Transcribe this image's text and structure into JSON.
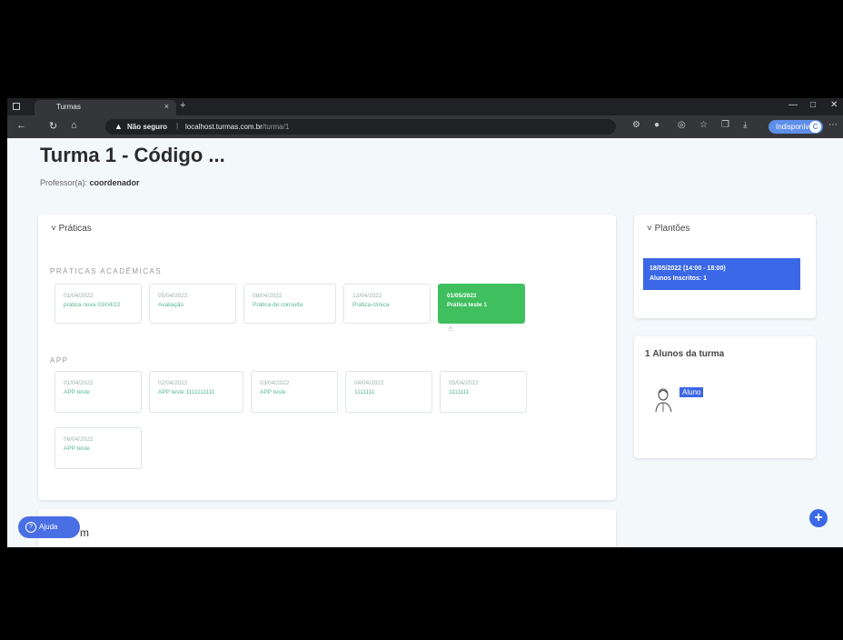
{
  "browser": {
    "tab_title": "Turmas",
    "tab_close": "×",
    "new_tab": "+",
    "not_secure": "Não seguro",
    "separator": "|",
    "url_host": "localhost.turmas.com.br",
    "url_path": "/turma/1",
    "profile_label": "Indisponível",
    "profile_initial": "C"
  },
  "page": {
    "title": "Turma 1 - Código ...",
    "professor_label": "Professor(a):",
    "professor_name": "coordenador"
  },
  "praticas": {
    "heading": "Práticas",
    "academicas_label": "PRÁTICAS ACADÊMICAS",
    "academicas": [
      {
        "l1": "01/04/2022",
        "l2": "prática nova 03/04/22",
        "active": false
      },
      {
        "l1": "05/04/2022",
        "l2": "Avaliação",
        "active": false
      },
      {
        "l1": "08/04/2022",
        "l2": "Prática de consulta",
        "active": false
      },
      {
        "l1": "12/04/2022",
        "l2": "Prática clínica",
        "active": false
      },
      {
        "l1": "01/05/2022",
        "l2": "Prática teste 1",
        "active": true
      }
    ],
    "app_label": "APP",
    "app": [
      {
        "l1": "01/04/2022",
        "l2": "APP teste"
      },
      {
        "l1": "02/04/2022",
        "l2": "APP teste 1111111111"
      },
      {
        "l1": "03/04/2022",
        "l2": "APP teste"
      },
      {
        "l1": "04/04/2022",
        "l2": "1111111"
      },
      {
        "l1": "05/04/2022",
        "l2": "1111111"
      },
      {
        "l1": "06/04/2022",
        "l2": "APP teste"
      }
    ]
  },
  "plantoes": {
    "heading": "Plantões",
    "line1": "18/05/2022 (14:00 - 18:00)",
    "line2": "Alunos Inscritos: 1"
  },
  "alunos": {
    "count": "1",
    "heading": "Alunos da turma",
    "student_name": "Aluno"
  },
  "help": {
    "label": "Ajuda",
    "q": "?"
  },
  "fab": {
    "label": "+"
  },
  "behind_text": "m",
  "colors": {
    "accent": "#3b68e6",
    "active_green": "#3fbf5e",
    "item_text": "#54b88e"
  }
}
